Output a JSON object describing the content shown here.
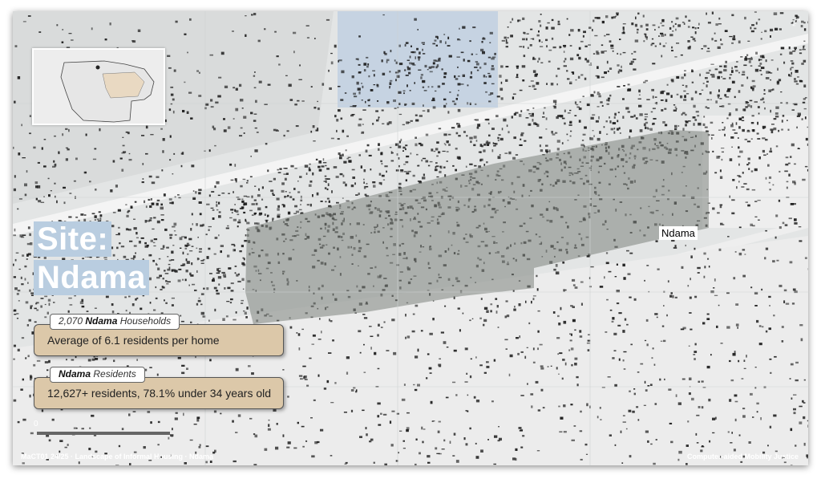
{
  "title": {
    "line1": "Site:",
    "line2": "Ndama"
  },
  "place_label": "Ndama",
  "cards": [
    {
      "tab_prefix": "2,070 ",
      "tab_name": "Ndama",
      "tab_suffix": " Households",
      "body": "Average of 6.1 residents per home"
    },
    {
      "tab_prefix": "",
      "tab_name": "Ndama",
      "tab_suffix": " Residents",
      "body": "12,627+ residents, 78.1% under 34 years old"
    }
  ],
  "footer": {
    "left": "MaCT01 24/25 · Landscape of Informal Housing · Ndama",
    "right": "Computer-aided Mobility Justice"
  },
  "scale": {
    "zero": "0"
  },
  "icons": {
    "expand": "expand-icon"
  },
  "colors": {
    "highlight": "#7d837e",
    "title_bg": "#b9cde0",
    "card_bg": "#dcc8a9",
    "blue_zone": "#c4d1e1",
    "building": "#1a1a1a"
  }
}
